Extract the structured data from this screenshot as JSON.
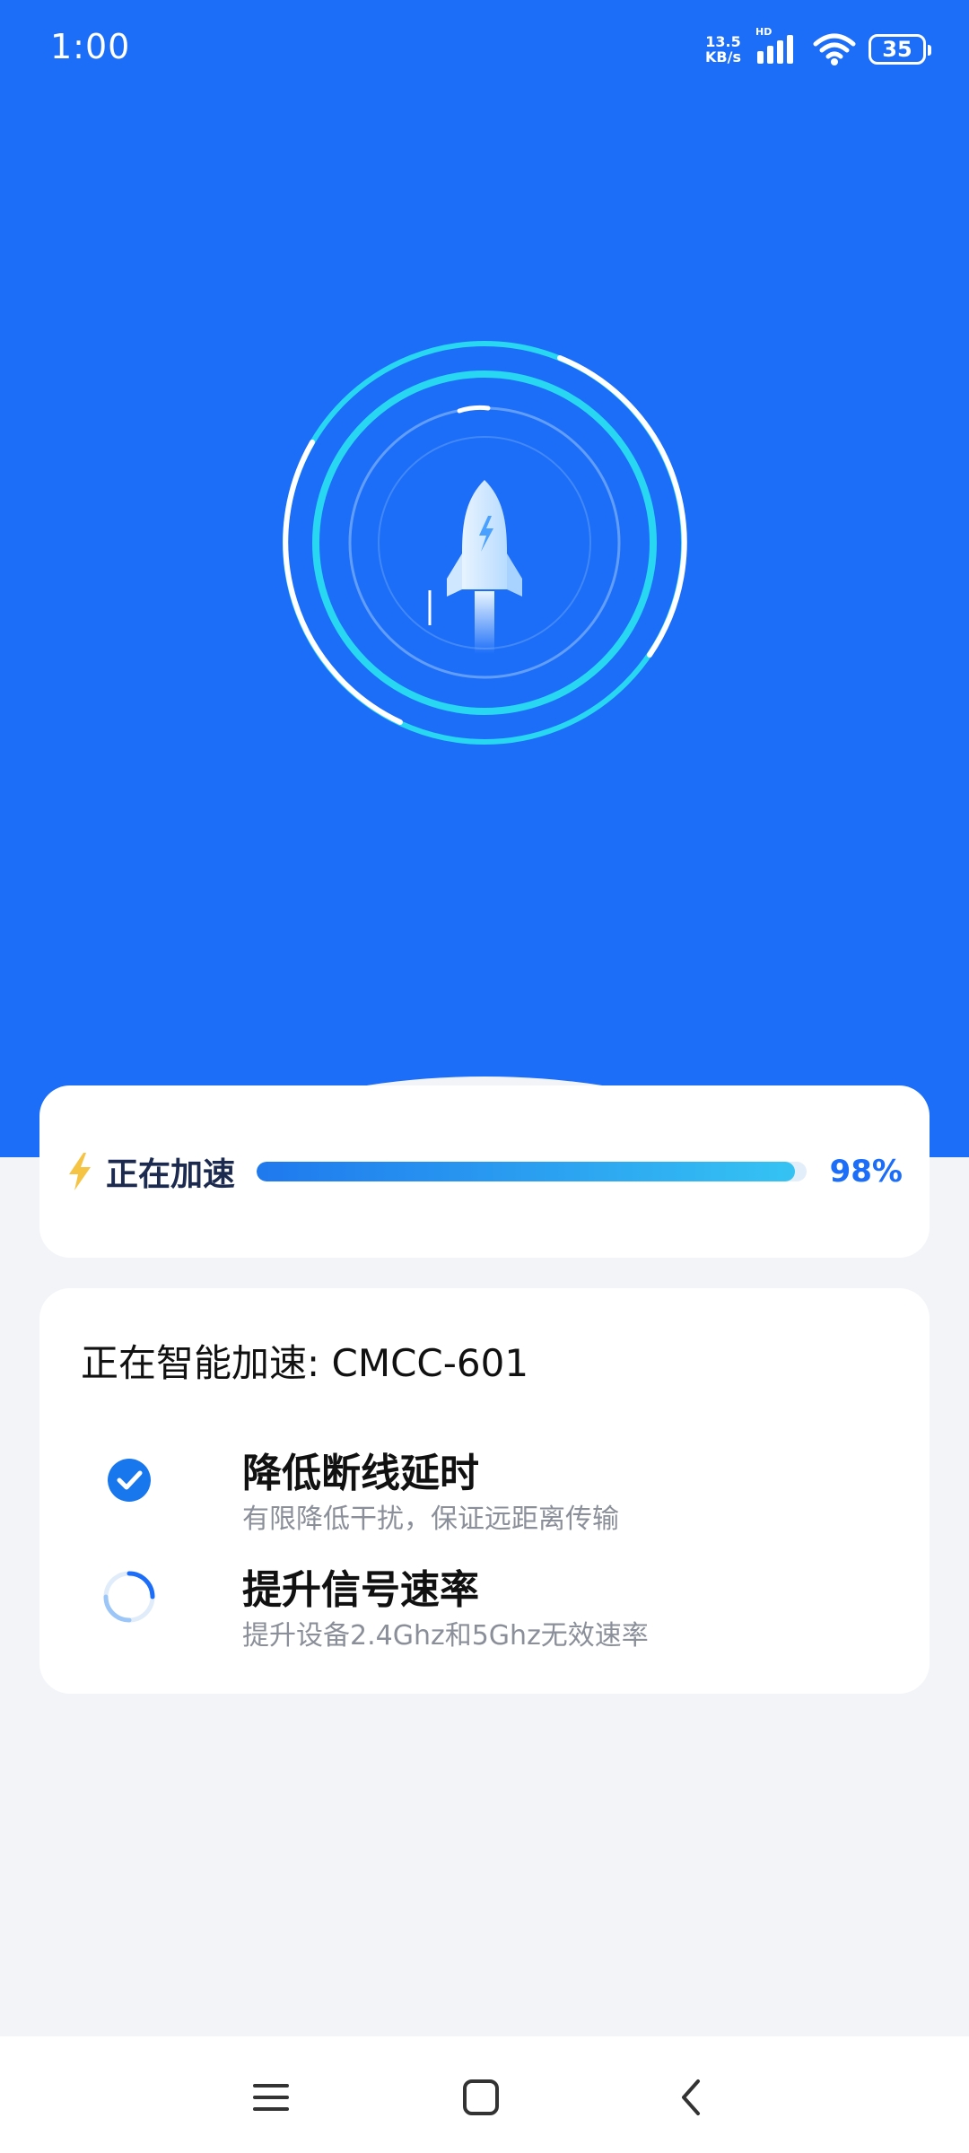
{
  "status_bar": {
    "time": "1:00",
    "net_speed_value": "13.5",
    "net_speed_unit": "KB/s",
    "signal_badge": "HD",
    "battery_level": "35"
  },
  "progress": {
    "label": "正在加速",
    "percent": 98,
    "percent_text": "98%"
  },
  "tasks": {
    "title": "正在智能加速: CMCC-601",
    "items": [
      {
        "name": "降低断线延时",
        "desc": "有限降低干扰，保证远距离传输",
        "state": "done"
      },
      {
        "name": "提升信号速率",
        "desc": "提升设备2.4Ghz和5Ghz无效速率",
        "state": "loading"
      }
    ]
  },
  "colors": {
    "primary": "#1c6ef8",
    "accent_cyan": "#28d7f2",
    "bolt": "#f6c445",
    "text_dark": "#111111",
    "text_muted": "#8a8f99"
  },
  "icons": {
    "bolt": "lightning-bolt",
    "done": "check-circle",
    "loading": "spinner",
    "nav_menu": "menu-lines",
    "nav_home": "square",
    "nav_back": "chevron-left"
  }
}
